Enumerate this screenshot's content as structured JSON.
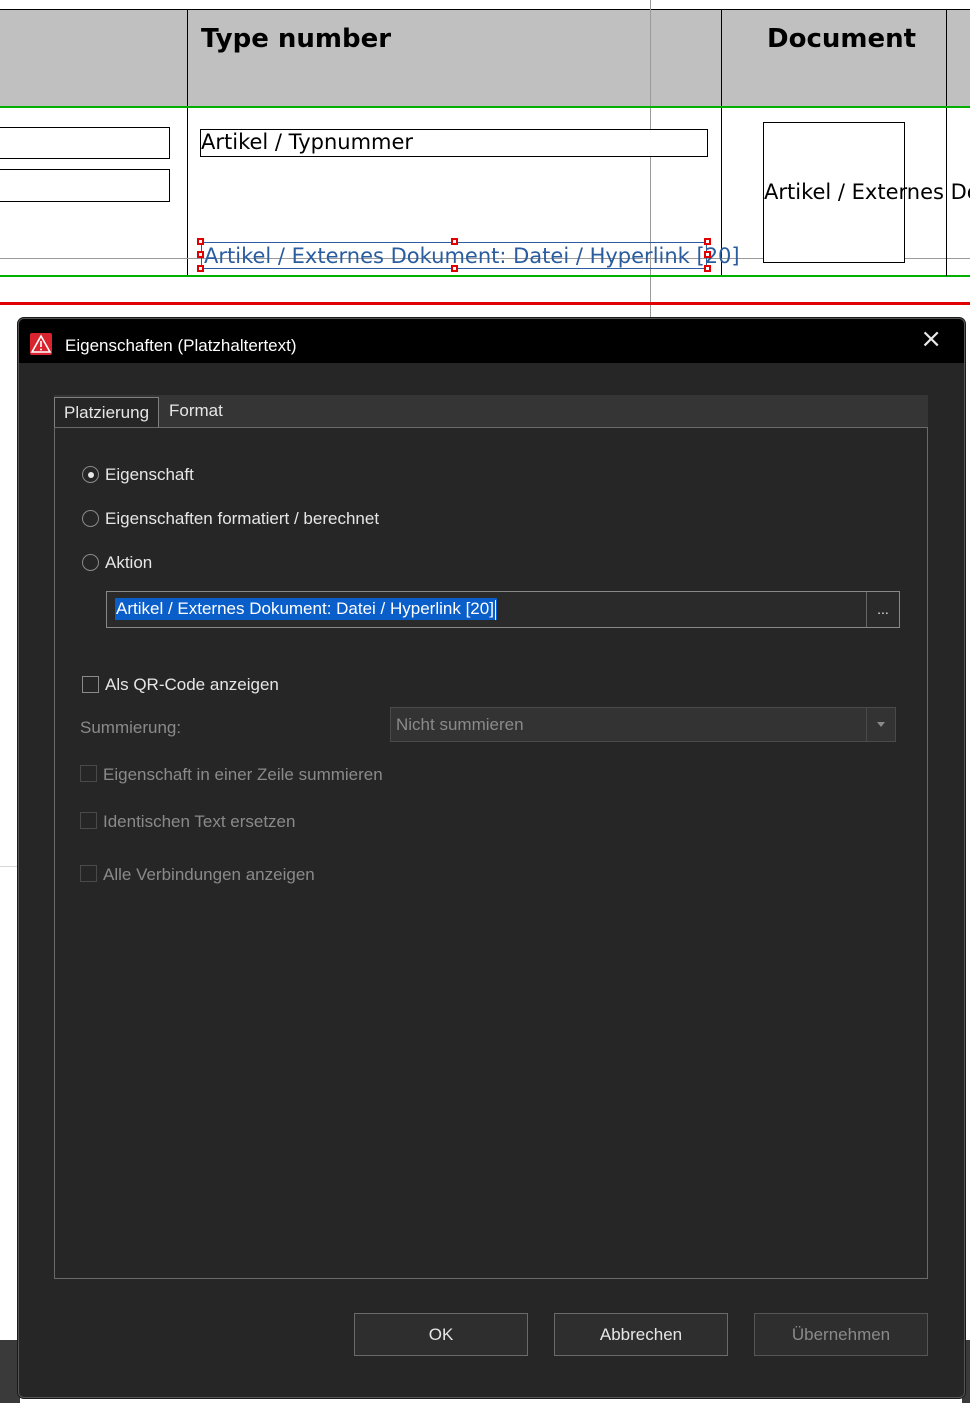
{
  "table": {
    "headers": {
      "type_number": "Type number",
      "document": "Document"
    },
    "type_number_field": "Artikel / Typnummer",
    "document_field": "Artikel / Externes Dokument: Datei / Hyperlink [20]",
    "selected_placeholder": "Artikel / Externes Dokument: Datei / Hyperlink [20]"
  },
  "dialog": {
    "title": "Eigenschaften (Platzhaltertext)",
    "tabs": [
      {
        "label": "Platzierung",
        "active": true
      },
      {
        "label": "Format",
        "active": false
      }
    ],
    "radios": [
      {
        "label": "Eigenschaft",
        "checked": true
      },
      {
        "label": "Eigenschaften formatiert / berechnet",
        "checked": false
      },
      {
        "label": "Aktion",
        "checked": false
      }
    ],
    "property_value": "Artikel / Externes Dokument: Datei / Hyperlink [20]",
    "ellipsis_label": "...",
    "qr_code_label": "Als QR-Code anzeigen",
    "summation": {
      "label": "Summierung:",
      "value": "Nicht summieren"
    },
    "disabled_options": [
      "Eigenschaft in einer Zeile summieren",
      "Identischen Text ersetzen",
      "Alle Verbindungen anzeigen"
    ],
    "buttons": {
      "ok": "OK",
      "cancel": "Abbrechen",
      "apply": "Übernehmen"
    }
  },
  "colors": {
    "dialog_bg": "#262626",
    "titlebar_bg": "#000000",
    "selection_blue": "#0a5ec9",
    "highlight_green": "#00b000",
    "highlight_red": "#e00000",
    "app_icon_red": "#d9232e"
  }
}
